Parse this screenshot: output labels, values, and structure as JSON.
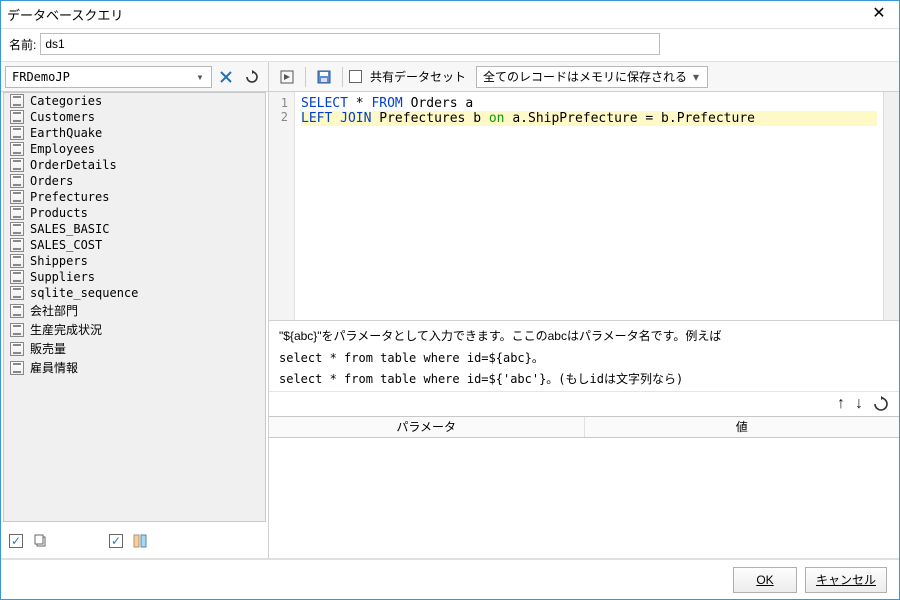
{
  "window": {
    "title": "データベースクエリ"
  },
  "name_label": "名前:",
  "name_value": "ds1",
  "connection": {
    "selected": "FRDemoJP"
  },
  "tables": [
    "Categories",
    "Customers",
    "EarthQuake",
    "Employees",
    "OrderDetails",
    "Orders",
    "Prefectures",
    "Products",
    "SALES_BASIC",
    "SALES_COST",
    "Shippers",
    "Suppliers",
    "sqlite_sequence",
    "会社部門",
    "生産完成状況",
    "販売量",
    "雇員情報"
  ],
  "toolbar": {
    "shared_label": "共有データセット",
    "storage_mode": "全てのレコードはメモリに保存される"
  },
  "sql": {
    "line1": {
      "a": "SELECT",
      "b": " * ",
      "c": "FROM",
      "d": " Orders a"
    },
    "line2": {
      "a": "LEFT JOIN",
      "b": " Prefectures b ",
      "c": "on",
      "d": " a.ShipPrefecture = b.Prefecture"
    }
  },
  "help": {
    "hint": "\"${abc}\"をパラメータとして入力できます。ここのabcはパラメータ名です。例えば",
    "ex1": "select * from table where id=${abc}。",
    "ex2": "select * from table where id=${'abc'}。(もしidは文字列なら)"
  },
  "param_headers": {
    "name": "パラメータ",
    "value": "値"
  },
  "buttons": {
    "ok": "OK",
    "cancel": "キャンセル"
  }
}
